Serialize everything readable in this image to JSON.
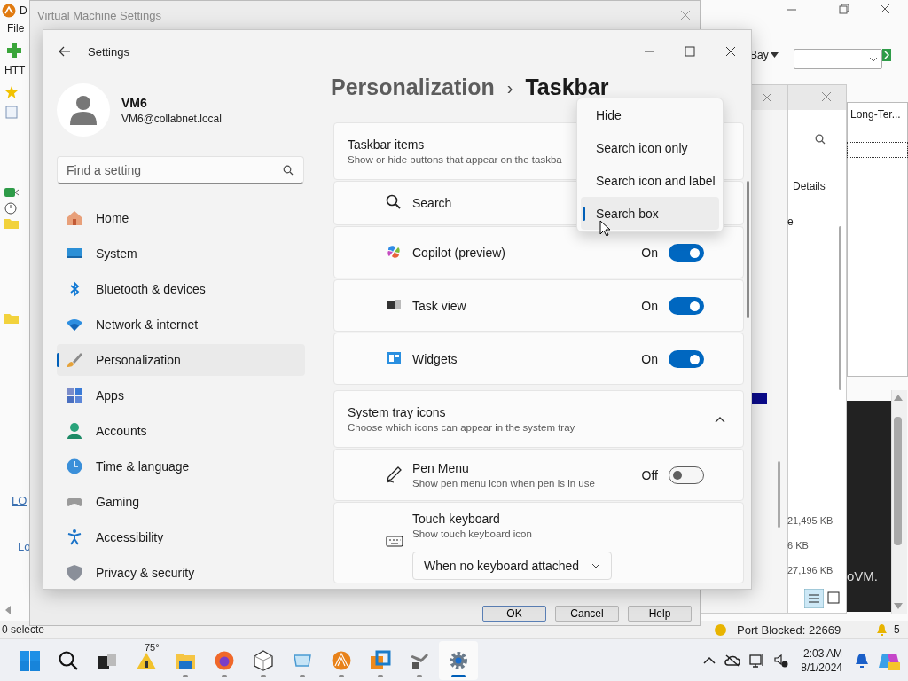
{
  "background_app": {
    "title": "D",
    "menu": [
      "File"
    ],
    "toolbar_label": "HTT",
    "filter_label": "Bay",
    "list_header": "Long-Ter...",
    "links": [
      "LO",
      "Lo"
    ],
    "banner_text": "oVM.",
    "status_bar": {
      "selection": "0 selecte",
      "port_status": "Port Blocked: 22669",
      "alert_count": "5"
    }
  },
  "side_window": {
    "tab": "Details",
    "label_fragment": "e",
    "sizes": [
      "21,495 KB",
      "6 KB",
      "27,196 KB"
    ]
  },
  "vm_settings": {
    "title": "Virtual Machine Settings",
    "buttons": [
      "OK",
      "Cancel",
      "Help"
    ]
  },
  "settings": {
    "title": "Settings",
    "user": {
      "name": "VM6",
      "email": "VM6@collabnet.local"
    },
    "search": {
      "placeholder": "Find a setting"
    },
    "nav": [
      {
        "label": "Home",
        "selected": false
      },
      {
        "label": "System",
        "selected": false
      },
      {
        "label": "Bluetooth & devices",
        "selected": false
      },
      {
        "label": "Network & internet",
        "selected": false
      },
      {
        "label": "Personalization",
        "selected": true
      },
      {
        "label": "Apps",
        "selected": false
      },
      {
        "label": "Accounts",
        "selected": false
      },
      {
        "label": "Time & language",
        "selected": false
      },
      {
        "label": "Gaming",
        "selected": false
      },
      {
        "label": "Accessibility",
        "selected": false
      },
      {
        "label": "Privacy & security",
        "selected": false
      }
    ],
    "breadcrumb": [
      "Personalization",
      "›",
      "Taskbar"
    ],
    "sections": [
      {
        "title": "Taskbar items",
        "subtitle": "Show or hide buttons that appear on the taskba",
        "rows": [
          {
            "kind": "dropdown",
            "label": "Search"
          },
          {
            "kind": "toggle",
            "label": "Copilot (preview)",
            "state_label": "On",
            "on": true
          },
          {
            "kind": "toggle",
            "label": "Task view",
            "state_label": "On",
            "on": true
          },
          {
            "kind": "toggle",
            "label": "Widgets",
            "state_label": "On",
            "on": true
          }
        ]
      },
      {
        "title": "System tray icons",
        "subtitle": "Choose which icons can appear in the system tray",
        "expanded": true,
        "rows": [
          {
            "kind": "toggle",
            "label": "Pen Menu",
            "description": "Show pen menu icon when pen is in use",
            "state_label": "Off",
            "on": false
          },
          {
            "kind": "select",
            "label": "Touch keyboard",
            "description": "Show touch keyboard icon",
            "value": "When no keyboard attached"
          }
        ]
      }
    ]
  },
  "dropdown": {
    "options": [
      {
        "label": "Hide",
        "selected": false
      },
      {
        "label": "Search icon only",
        "selected": false
      },
      {
        "label": "Search icon and label",
        "selected": false
      },
      {
        "label": "Search box",
        "selected": true
      }
    ]
  },
  "taskbar": {
    "weather": "75°",
    "apps": [
      {
        "running": false,
        "active": false
      },
      {
        "running": false,
        "active": false
      },
      {
        "running": false,
        "active": false
      },
      {
        "running": false,
        "active": false
      },
      {
        "running": true,
        "active": false
      },
      {
        "running": true,
        "active": false
      },
      {
        "running": true,
        "active": false
      },
      {
        "running": true,
        "active": false
      },
      {
        "running": true,
        "active": false
      },
      {
        "running": true,
        "active": false
      },
      {
        "running": true,
        "active": false
      },
      {
        "running": true,
        "active": true
      }
    ],
    "time": "2:03 AM",
    "date": "8/1/2024"
  }
}
